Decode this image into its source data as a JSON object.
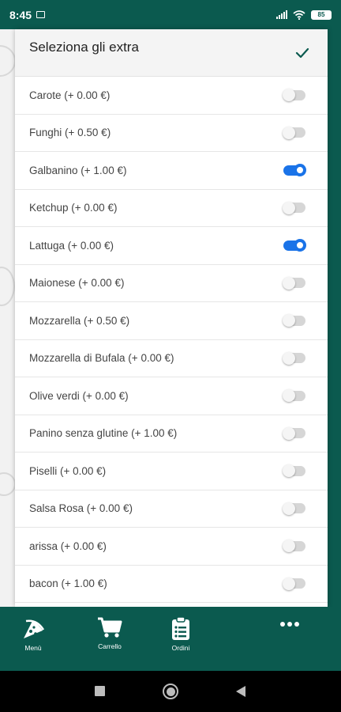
{
  "status_bar": {
    "time": "8:45",
    "battery": "85"
  },
  "dialog": {
    "title": "Seleziona gli extra",
    "extras": [
      {
        "label": "Carote (+ 0.00 €)",
        "checked": false
      },
      {
        "label": "Funghi (+ 0.50 €)",
        "checked": false
      },
      {
        "label": "Galbanino (+ 1.00 €)",
        "checked": true
      },
      {
        "label": "Ketchup (+ 0.00 €)",
        "checked": false
      },
      {
        "label": "Lattuga (+ 0.00 €)",
        "checked": true
      },
      {
        "label": "Maionese (+ 0.00 €)",
        "checked": false
      },
      {
        "label": "Mozzarella (+ 0.50 €)",
        "checked": false
      },
      {
        "label": "Mozzarella di Bufala (+ 0.00 €)",
        "checked": false
      },
      {
        "label": "Olive verdi (+ 0.00 €)",
        "checked": false
      },
      {
        "label": "Panino senza glutine (+ 1.00 €)",
        "checked": false
      },
      {
        "label": "Piselli (+ 0.00 €)",
        "checked": false
      },
      {
        "label": "Salsa Rosa (+ 0.00 €)",
        "checked": false
      },
      {
        "label": "arissa (+ 0.00 €)",
        "checked": false
      },
      {
        "label": "bacon (+ 1.00 €)",
        "checked": false
      }
    ]
  },
  "bottom_nav": {
    "menu": "Menù",
    "cart": "Carrello",
    "orders": "Ordini"
  },
  "colors": {
    "brand": "#0b5a4f",
    "toggle_on": "#1a73e8"
  }
}
